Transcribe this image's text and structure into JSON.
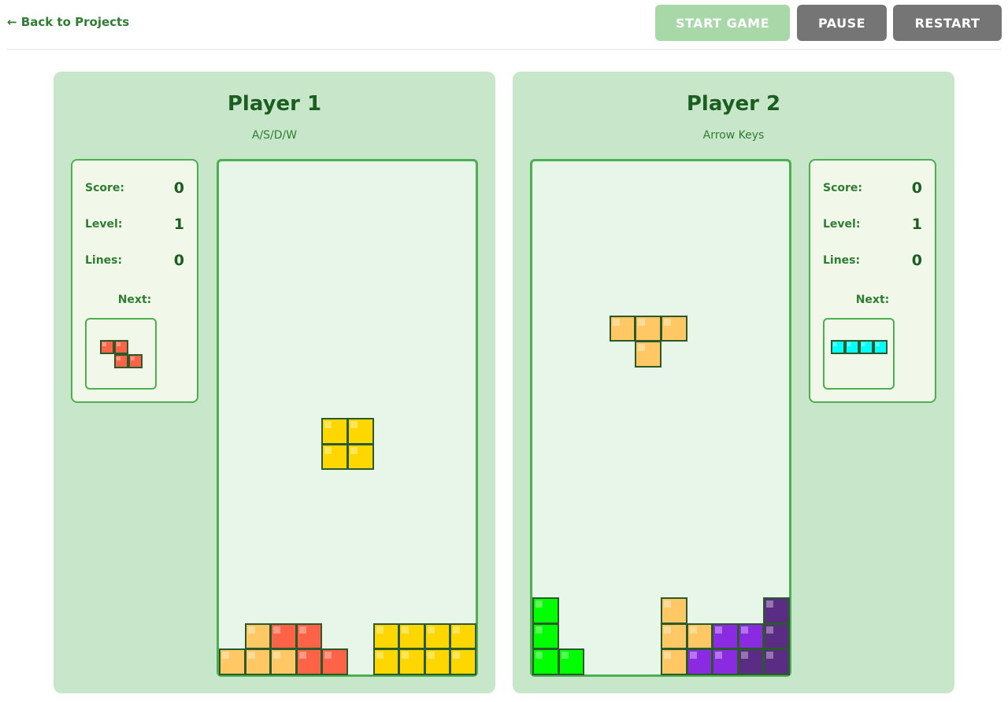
{
  "nav": {
    "back_label": "← Back to Projects"
  },
  "toolbar": {
    "start_label": "START GAME",
    "pause_label": "PAUSE",
    "restart_label": "RESTART"
  },
  "colors": {
    "orange": "#ffc864",
    "red": "#ff6347",
    "yellow": "#ffd700",
    "green": "#00ff00",
    "purple": "#8a2be2",
    "dark_purple": "#5b2c83",
    "cyan": "#00ffff"
  },
  "players": [
    {
      "title": "Player 1",
      "controls": "A/S/D/W",
      "score_label": "Score:",
      "score": "0",
      "level_label": "Level:",
      "level": "1",
      "lines_label": "Lines:",
      "lines": "0",
      "next_label": "Next:",
      "next_piece": {
        "name": "Z",
        "color": "red",
        "cells": [
          [
            0,
            0
          ],
          [
            1,
            0
          ],
          [
            1,
            1
          ],
          [
            2,
            1
          ]
        ]
      },
      "board": {
        "cols": 10,
        "rows": 20,
        "cells": [
          [
            1,
            18,
            "orange"
          ],
          [
            2,
            18,
            "red"
          ],
          [
            3,
            18,
            "red"
          ],
          [
            6,
            18,
            "yellow"
          ],
          [
            7,
            18,
            "yellow"
          ],
          [
            8,
            18,
            "yellow"
          ],
          [
            9,
            18,
            "yellow"
          ],
          [
            0,
            19,
            "orange"
          ],
          [
            1,
            19,
            "orange"
          ],
          [
            2,
            19,
            "orange"
          ],
          [
            3,
            19,
            "red"
          ],
          [
            4,
            19,
            "red"
          ],
          [
            6,
            19,
            "yellow"
          ],
          [
            7,
            19,
            "yellow"
          ],
          [
            8,
            19,
            "yellow"
          ],
          [
            9,
            19,
            "yellow"
          ],
          [
            4,
            10,
            "yellow"
          ],
          [
            5,
            10,
            "yellow"
          ],
          [
            4,
            11,
            "yellow"
          ],
          [
            5,
            11,
            "yellow"
          ]
        ]
      }
    },
    {
      "title": "Player 2",
      "controls": "Arrow Keys",
      "score_label": "Score:",
      "score": "0",
      "level_label": "Level:",
      "level": "1",
      "lines_label": "Lines:",
      "lines": "0",
      "next_label": "Next:",
      "next_piece": {
        "name": "I",
        "color": "cyan",
        "cells": [
          [
            0,
            0
          ],
          [
            1,
            0
          ],
          [
            2,
            0
          ],
          [
            3,
            0
          ]
        ]
      },
      "board": {
        "cols": 10,
        "rows": 20,
        "cells": [
          [
            3,
            6,
            "orange"
          ],
          [
            4,
            6,
            "orange"
          ],
          [
            5,
            6,
            "orange"
          ],
          [
            4,
            7,
            "orange"
          ],
          [
            0,
            17,
            "green"
          ],
          [
            0,
            18,
            "green"
          ],
          [
            0,
            19,
            "green"
          ],
          [
            1,
            19,
            "green"
          ],
          [
            5,
            17,
            "orange"
          ],
          [
            5,
            18,
            "orange"
          ],
          [
            5,
            19,
            "orange"
          ],
          [
            6,
            18,
            "orange"
          ],
          [
            7,
            18,
            "purple"
          ],
          [
            8,
            18,
            "purple"
          ],
          [
            6,
            19,
            "purple"
          ],
          [
            7,
            19,
            "purple"
          ],
          [
            9,
            17,
            "dark_purple"
          ],
          [
            9,
            18,
            "dark_purple"
          ],
          [
            8,
            19,
            "dark_purple"
          ],
          [
            9,
            19,
            "dark_purple"
          ]
        ]
      }
    }
  ]
}
